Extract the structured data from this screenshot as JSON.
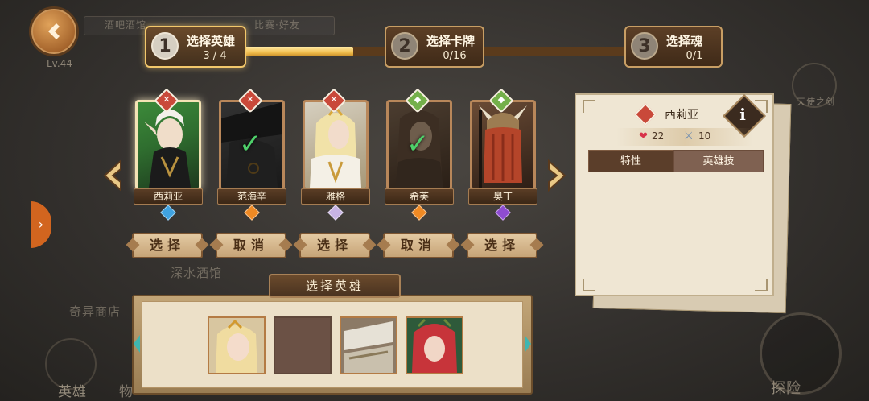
{
  "header": {
    "back_icon": "back-arrow-icon",
    "level": "Lv.44"
  },
  "background_labels": [
    "酒吧酒馆",
    "比赛·好友",
    "深水酒馆",
    "奇异商店",
    "英雄",
    "物",
    "探险",
    "天使之剑"
  ],
  "steps": [
    {
      "number": "1",
      "title": "选择英雄",
      "count": "3 / 4",
      "active": true
    },
    {
      "number": "2",
      "title": "选择卡牌",
      "count": "0/16",
      "active": false
    },
    {
      "number": "3",
      "title": "选择魂",
      "count": "0/1",
      "active": false
    }
  ],
  "progress": {
    "fraction": 0.29,
    "fill_color": "#f0be4e"
  },
  "heroes": [
    {
      "name": "西莉亚",
      "badge": "red",
      "gem": "blue",
      "state": "selected",
      "action": "选择"
    },
    {
      "name": "范海辛",
      "badge": "red",
      "gem": "orange",
      "state": "checked",
      "action": "取消"
    },
    {
      "name": "雅格",
      "badge": "red",
      "gem": "lilac",
      "state": "normal",
      "action": "选择"
    },
    {
      "name": "希芙",
      "badge": "green",
      "gem": "orange",
      "state": "checked",
      "action": "取消"
    },
    {
      "name": "奥丁",
      "badge": "green",
      "gem": "purple",
      "state": "normal",
      "action": "选择"
    }
  ],
  "bottom": {
    "title": "选择英雄",
    "slots": [
      "filled",
      "empty",
      "filled",
      "filled"
    ]
  },
  "detail": {
    "name": "西莉亚",
    "info_icon": "info-icon",
    "hp_icon": "heart-icon",
    "hp": "22",
    "attack_icon": "sword-icon",
    "attack": "10",
    "tabs": [
      "特性",
      "英雄技"
    ],
    "active_tab": "特性"
  },
  "colors": {
    "accent": "#f3c86b",
    "selected_check": "#4ed06a",
    "badge_red": "#c9493a",
    "badge_green": "#74b04a"
  }
}
